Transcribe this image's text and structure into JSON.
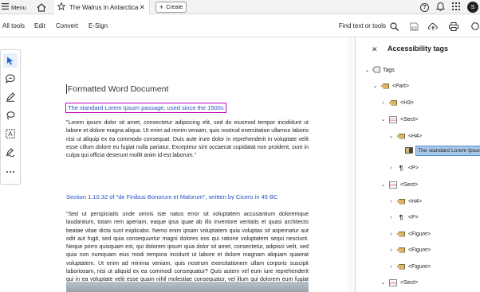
{
  "topbar": {
    "menu_label": "Menu",
    "tab_title": "The Walrus in Antarctica",
    "create_label": "Create",
    "avatar_letter": "S"
  },
  "menubar": {
    "all_tools": "All tools",
    "edit": "Edit",
    "convert": "Convert",
    "esign": "E-Sign",
    "find": "Find text or tools"
  },
  "document": {
    "title": "Formatted Word Document",
    "heading_selected": "The standard Lorem Ipsum passage, used since the 1500s",
    "para1": "\"Lorem ipsum dolor sit amet, consectetur adipiscing elit, sed do eiusmod tempor incididunt ut labore et dolore magna aliqua. Ut enim ad minim veniam, quis nostrud exercitation ullamco laboris nisi ut aliquip ex ea commodo consequat. Duis aute irure dolor in reprehenderit in voluptate velit esse cillum dolore eu fugiat nulla pariatur. Excepteur sint occaecat cupidatat non proident, sunt in culpa qui officia deserunt mollit anim id est laborum.\"",
    "heading2": "Section 1.10.32 of \"de Finibus Bonorum et Malorum\", written by Cicero in 45 BC",
    "para2": "\"Sed ut perspiciatis unde omnis iste natus error sit voluptatem accusantium doloremque laudantium, totam rem aperiam, eaque ipsa quae ab illo inventore veritatis et quasi architecto beatae vitae dicta sunt explicabo. Nemo enim ipsam voluptatem quia voluptas sit aspernatur aut odit aut fugit, sed quia consequuntur magni dolores eos qui ratione voluptatem sequi nesciunt. Neque porro quisquam est, qui dolorem ipsum quia dolor sit amet, consectetur, adipisci velit, sed quia non numquam eius modi tempora incidunt ut labore et dolore magnam aliquam quaerat voluptatem. Ut enim ad minima veniam, quis nostrum exercitationem ullam corporis suscipit laboriosam, nisi ut aliquid ex ea commodi consequatur? Quis autem vel eum iure reprehenderit qui in ea voluptate velit esse quam nihil molestiae consequatur, vel illum qui dolorem eum fugiat quo voluptas nulla pariatur?\""
  },
  "panel": {
    "title": "Accessibility tags",
    "tree": [
      {
        "label": "Tags",
        "icon": "tag-root-icon",
        "chevron": "v"
      },
      {
        "label": "<Part>",
        "icon": "tag-icon",
        "chevron": "v"
      },
      {
        "label": "<H3>",
        "icon": "tag-icon",
        "chevron": ">"
      },
      {
        "label": "<Sect>",
        "icon": "section-icon",
        "chevron": "v"
      },
      {
        "label": "<H4>",
        "icon": "tag-icon",
        "chevron": "v"
      },
      {
        "label": "The standard Lorem Ipsum",
        "icon": "text-content-icon",
        "chevron": ""
      },
      {
        "label": "<P>",
        "icon": "paragraph-icon",
        "chevron": ">"
      },
      {
        "label": "<Sect>",
        "icon": "section-icon",
        "chevron": "v"
      },
      {
        "label": "<H4>",
        "icon": "tag-icon",
        "chevron": ">"
      },
      {
        "label": "<P>",
        "icon": "paragraph-icon",
        "chevron": ">"
      },
      {
        "label": "<Figure>",
        "icon": "tag-icon",
        "chevron": ">"
      },
      {
        "label": "<Figure>",
        "icon": "tag-icon",
        "chevron": ">"
      },
      {
        "label": "<Figure>",
        "icon": "tag-icon",
        "chevron": ">"
      },
      {
        "label": "<Sect>",
        "icon": "section-icon",
        "chevron": "v"
      }
    ]
  },
  "colors": {
    "selection_border": "#c000c0",
    "heading_blue": "#2a52be",
    "tree_selected": "#a9c7e8"
  }
}
